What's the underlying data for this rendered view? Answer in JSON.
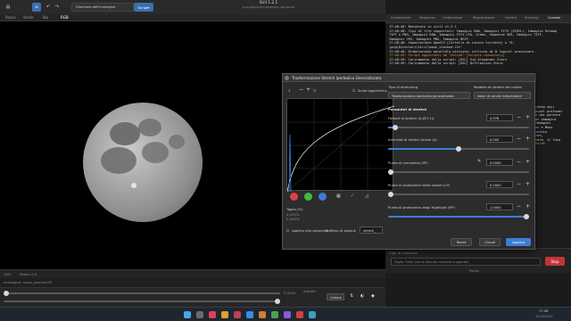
{
  "window": {
    "title": "Siril 1.2.1",
    "subtitle": "D:\\png\\Directory\\Siril\\moon_stacked.fit"
  },
  "toolbar": {
    "folder_label": "Directorio dell'immagine",
    "script_label": "Script"
  },
  "tabs": [
    "Rosso",
    "Verde",
    "Blu",
    "RGB"
  ],
  "right_tabs": [
    "Conversione",
    "Sequenza",
    "Calibrazione",
    "Registrazione",
    "Grafica",
    "Stacking",
    "Console"
  ],
  "console_lines": [
    {
      "text": "17:48:48: Benvenuto in siril v1.2.1",
      "color": "normal"
    },
    {
      "text": "17:48:48: Tipi di file supportati: Immagini RAW, Immagini FITS (SIRIL), Immagini Bitmap",
      "color": "normal"
    },
    {
      "text": "TIFF e PNG, Immagini RAW, Immagini FITS-CFA, Video, Sequenze SER, Immagini TIFF,",
      "color": "normal"
    },
    {
      "text": "Immagini JPG, Immagini PNG, Immagini HEIF.",
      "color": "normal"
    },
    {
      "text": "17:48:48: Impostazione OpenCV [Cartella di Lavoro Corrente] a \"D:",
      "color": "normal"
    },
    {
      "text": "\\png\\Directory\\Siril\\moon_stacked.fit\"",
      "color": "normal"
    },
    {
      "text": "17:48:48: Elaborazione parallela attivata: utilizzo di 8 logical processors.",
      "color": "normal"
    },
    {
      "text": "17:48:49: Script aggiornati da \"GitLab\" [Scripts repository]",
      "color": "orange"
    },
    {
      "text": "17:48:49: Caricamento dello script: [OSC] Via Alexander Stars",
      "color": "normal"
    },
    {
      "text": "17:48:49: Caricamento dello script: [OSC] Diffraction Stars",
      "color": "normal"
    }
  ],
  "console_snippets": [
    "(deep-sky)",
    "pixel profondi",
    "e dai parente",
    "di immagini",
    "Immagini",
    "ai e Mono",
    "inizio",
    "con,",
    "tare, il fuso",
    "Verde"
  ],
  "cmd": {
    "label": "Riga di comando",
    "placeholder": "Digita \"help\" per la lista dei comandi supportati",
    "stop_label": "Stop",
    "status": "Pronto"
  },
  "status": {
    "left_a": "29%",
    "left_b": "Radio: 0.0",
    "left_c": "Immagine: moon_stacked.fit",
    "mode": "Lineare",
    "auto": "AutoStr",
    "zoom": "0.0000"
  },
  "taskbar": {
    "time": "17:58",
    "date": "31/05/2024"
  },
  "dialog": {
    "title": "Trasformazione Stretch Iperbolica Generalizzata",
    "hist_zoom": "1",
    "log_scale_label": "Scala logaritmica",
    "stretch_type_label": "Tipo di stretching",
    "stretch_type_value": "Trasformazione iperbolica generalizzata",
    "color_model_label": "Modello di stretch del colore",
    "color_model_value": "Valori di canale indipendenti",
    "params_label": "Parametri di stretch",
    "params": [
      {
        "label": "Fattore di stretch (ln(D+1))",
        "value": "0.978",
        "fraction": 0.05
      },
      {
        "label": "Intensità di stretch locale (b)",
        "value": "0.000",
        "fraction": 0.5
      },
      {
        "label": "Punto di simmetria (SP)",
        "value": "0.0000",
        "fraction": 0.0
      },
      {
        "label": "Punto di protezione delle ombre (LP)",
        "value": "0.0000",
        "fraction": 0.0
      },
      {
        "label": "Punto di protezione degli Highlight (HP)",
        "value": "1.0000",
        "fraction": 1.0
      }
    ],
    "clip_title": "Taglio (%)",
    "clip_values": [
      "0.000%",
      "0.000%"
    ],
    "sequence_label": "Applica alla sequenza",
    "output_prefix_label": "Prefisso di output:",
    "output_prefix_value": "stretch_",
    "buttons": {
      "reset": "Reset",
      "close": "Chiudi",
      "apply": "Applica"
    },
    "colors": {
      "accent": "#3d7dd8",
      "red": "#e04040",
      "green": "#3cbc3c",
      "blue": "#3d7dd8"
    }
  }
}
